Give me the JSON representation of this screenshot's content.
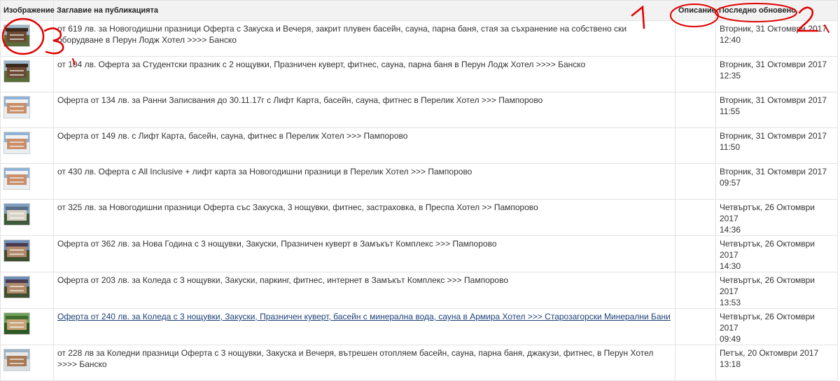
{
  "table": {
    "headers": {
      "image": "Изображение",
      "title": "Заглавие на публикацията",
      "description": "Описание",
      "updated": "Последно обновено"
    },
    "rows": [
      {
        "thumb": "hotel-photo",
        "title": "от 619 лв. за Новогодишни празници Оферта с Закуска и Вечеря, закрит плувен басейн, сауна, парна баня, стая за съхранение на собствено ски оборудване в Перун Лодж Хотел >>>> Банско",
        "link": false,
        "description": "",
        "date": "Вторник, 31 Октомври 2017",
        "time": "12:40"
      },
      {
        "thumb": "hotel-photo",
        "title": "от 104 лв. Оферта за Студентски празник с 2 нощувки, Празничен куверт, фитнес, сауна, парна баня в Перун Лодж Хотел >>>> Банско",
        "link": false,
        "description": "",
        "date": "Вторник, 31 Октомври 2017",
        "time": "12:35"
      },
      {
        "thumb": "snow-hotel-photo",
        "title": "Оферта от 134 лв. за Ранни Записвания до 30.11.17г с Лифт Карта, басейн, сауна, фитнес в Перелик Хотел >>> Пампорово",
        "link": false,
        "description": "",
        "date": "Вторник, 31 Октомври 2017",
        "time": "11:55"
      },
      {
        "thumb": "snow-hotel-photo",
        "title": "Оферта от 149 лв. с Лифт Карта, басейн, сауна, фитнес в Перелик Хотел >>> Пампорово",
        "link": false,
        "description": "",
        "date": "Вторник, 31 Октомври 2017",
        "time": "11:50"
      },
      {
        "thumb": "snow-hotel-photo",
        "title": "от 430 лв. Оферта с All Inclusive + лифт карта за Новогодишни празници в Перелик Хотел >>> Пампорово",
        "link": false,
        "description": "",
        "date": "Вторник, 31 Октомври 2017",
        "time": "09:57"
      },
      {
        "thumb": "mountain-hotel-photo",
        "title": "от 325 лв. за Новогодишни празници Оферта със Закуска, 3 нощувки, фитнес, застраховка, в Преспа Хотел >> Пампорово",
        "link": false,
        "description": "",
        "date": "Четвъртък, 26 Октомври 2017",
        "time": "14:36"
      },
      {
        "thumb": "castle-photo",
        "title": "Оферта от 362 лв. за Нова Година с 3 нощувки, Закуски, Празничен куверт в Замъкът Комплекс >>> Пампорово",
        "link": false,
        "description": "",
        "date": "Четвъртък, 26 Октомври 2017",
        "time": "14:30"
      },
      {
        "thumb": "castle-photo",
        "title": "Оферта от 203 лв. за Коледа с 3 нощувки, Закуски, паркинг, фитнес, интернет в Замъкът Комплекс >>> Пампорово",
        "link": false,
        "description": "",
        "date": "Четвъртък, 26 Октомври 2017",
        "time": "13:53"
      },
      {
        "thumb": "spa-hotel-photo",
        "title": "Оферта от 240 лв. за Коледа с 3 нощувки, Закуски, Празничен куверт, басейн с минерална вода, сауна в Армира Хотел >>> Старозагорски Минерални Бани",
        "link": true,
        "description": "",
        "date": "Четвъртък, 26 Октомври 2017",
        "time": "09:49"
      },
      {
        "thumb": "winter-hotel-photo",
        "title": "от 228 лв за Коледни празници Оферта с 3 нощувки, Закуска и Вечеря, вътрешен отопляем басейн, сауна, парна баня, джакузи, фитнес, в Перун Хотел >>>> Банско",
        "link": false,
        "description": "",
        "date": "Петък, 20 Октомври 2017",
        "time": "13:18"
      }
    ]
  },
  "annotations": {
    "marks": [
      "1",
      "2",
      "3"
    ],
    "color": "#e00000"
  },
  "colors": {
    "link": "#1a3f78",
    "header_bg": "#f2f2f2",
    "border": "#e3e3e3"
  }
}
